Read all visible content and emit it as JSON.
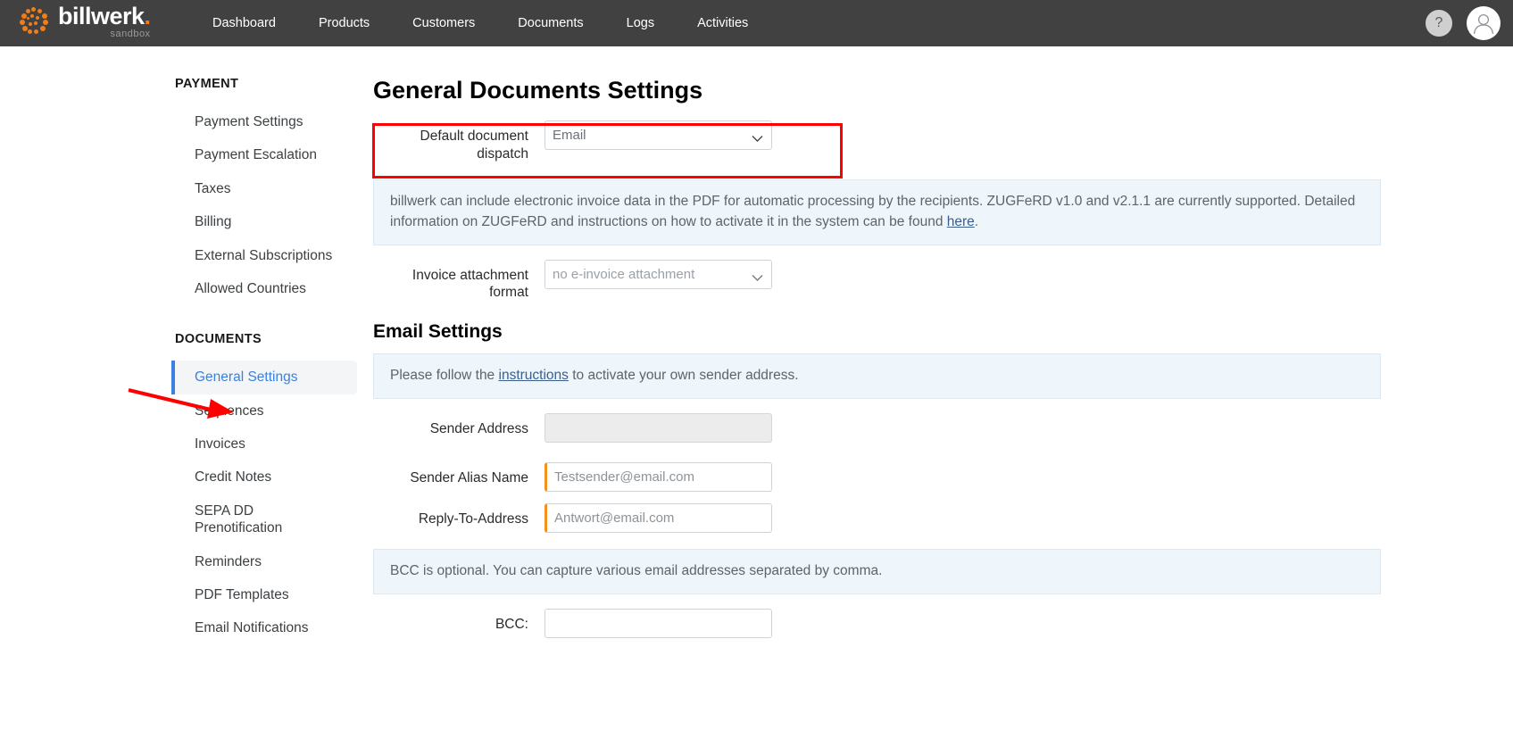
{
  "brand": {
    "name": "billwerk",
    "name_suffix": ".",
    "environment": "sandbox",
    "logo_icon": "billwerk-dots-logo",
    "accent_color": "#f07d1a",
    "topbar_color": "#414141"
  },
  "topnav": {
    "items": [
      {
        "label": "Dashboard",
        "name": "nav-dashboard"
      },
      {
        "label": "Products",
        "name": "nav-products"
      },
      {
        "label": "Customers",
        "name": "nav-customers"
      },
      {
        "label": "Documents",
        "name": "nav-documents"
      },
      {
        "label": "Logs",
        "name": "nav-logs"
      },
      {
        "label": "Activities",
        "name": "nav-activities"
      }
    ],
    "help_label": "?",
    "help_icon": "question-mark-icon",
    "avatar_icon": "user-avatar-icon"
  },
  "sidebar": {
    "groups": [
      {
        "title": "PAYMENT",
        "items": [
          {
            "label": "Payment Settings",
            "active": false
          },
          {
            "label": "Payment Escalation",
            "active": false
          },
          {
            "label": "Taxes",
            "active": false
          },
          {
            "label": "Billing",
            "active": false
          },
          {
            "label": "External Subscriptions",
            "active": false
          },
          {
            "label": "Allowed Countries",
            "active": false
          }
        ]
      },
      {
        "title": "DOCUMENTS",
        "items": [
          {
            "label": "General Settings",
            "active": true
          },
          {
            "label": "Sequences",
            "active": false
          },
          {
            "label": "Invoices",
            "active": false
          },
          {
            "label": "Credit Notes",
            "active": false
          },
          {
            "label": "SEPA DD Prenotification",
            "active": false
          },
          {
            "label": "Reminders",
            "active": false
          },
          {
            "label": "PDF Templates",
            "active": false
          },
          {
            "label": "Email Notifications",
            "active": false
          }
        ]
      }
    ]
  },
  "main": {
    "title": "General Documents Settings",
    "dispatch": {
      "label": "Default document dispatch",
      "value": "Email",
      "chevron_icon": "chevron-down-icon"
    },
    "zugferd_banner": {
      "text_before_link": "billwerk can include electronic invoice data in the PDF for automatic processing by the recipients. ZUGFeRD v1.0 and v2.1.1 are currently supported. Detailed information on ZUGFeRD and instructions on how to activate it in the system can be found ",
      "link_text": "here",
      "text_after_link": "."
    },
    "attachment": {
      "label": "Invoice attachment format",
      "value": "no e-invoice attachment",
      "chevron_icon": "chevron-down-icon"
    },
    "email_section": {
      "title": "Email Settings",
      "instructions_banner": {
        "text_before_link": "Please follow the ",
        "link_text": "instructions",
        "text_after_link": " to activate your own sender address."
      },
      "sender_address": {
        "label": "Sender Address",
        "value": ""
      },
      "sender_alias": {
        "label": "Sender Alias Name",
        "placeholder": "Testsender@email.com",
        "value": ""
      },
      "reply_to": {
        "label": "Reply-To-Address",
        "placeholder": "Antwort@email.com",
        "value": ""
      },
      "bcc_banner": {
        "text": "BCC is optional. You can capture various email addresses separated by comma."
      },
      "bcc": {
        "label": "BCC:",
        "value": ""
      }
    }
  },
  "annotations": {
    "highlight_color": "#ff0000",
    "highlight_target": "default-document-dispatch-row",
    "arrow_target": "sidebar-item-general-settings"
  }
}
